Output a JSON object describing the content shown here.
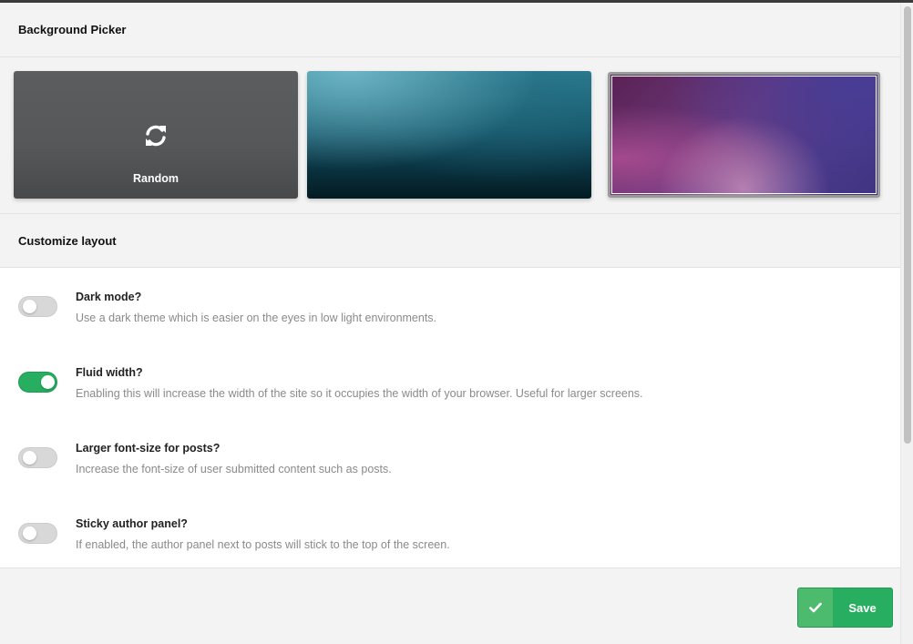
{
  "background_picker": {
    "title": "Background Picker",
    "random_label": "Random",
    "options": [
      {
        "name": "Random",
        "icon": "refresh-icon"
      },
      {
        "name": "teal-gradient"
      },
      {
        "name": "purple-gradient",
        "selected": true
      }
    ]
  },
  "customize_layout": {
    "title": "Customize layout",
    "options": [
      {
        "title": "Dark mode?",
        "description": "Use a dark theme which is easier on the eyes in low light environments.",
        "enabled": false
      },
      {
        "title": "Fluid width?",
        "description": "Enabling this will increase the width of the site so it occupies the width of your browser. Useful for larger screens.",
        "enabled": true
      },
      {
        "title": "Larger font-size for posts?",
        "description": "Increase the font-size of user submitted content such as posts.",
        "enabled": false
      },
      {
        "title": "Sticky author panel?",
        "description": "If enabled, the author panel next to posts will stick to the top of the screen.",
        "enabled": false
      }
    ]
  },
  "footer": {
    "save_label": "Save",
    "save_icon": "check-icon"
  },
  "colors": {
    "accent_green": "#27ae60",
    "header_bg": "#f3f3f3"
  }
}
